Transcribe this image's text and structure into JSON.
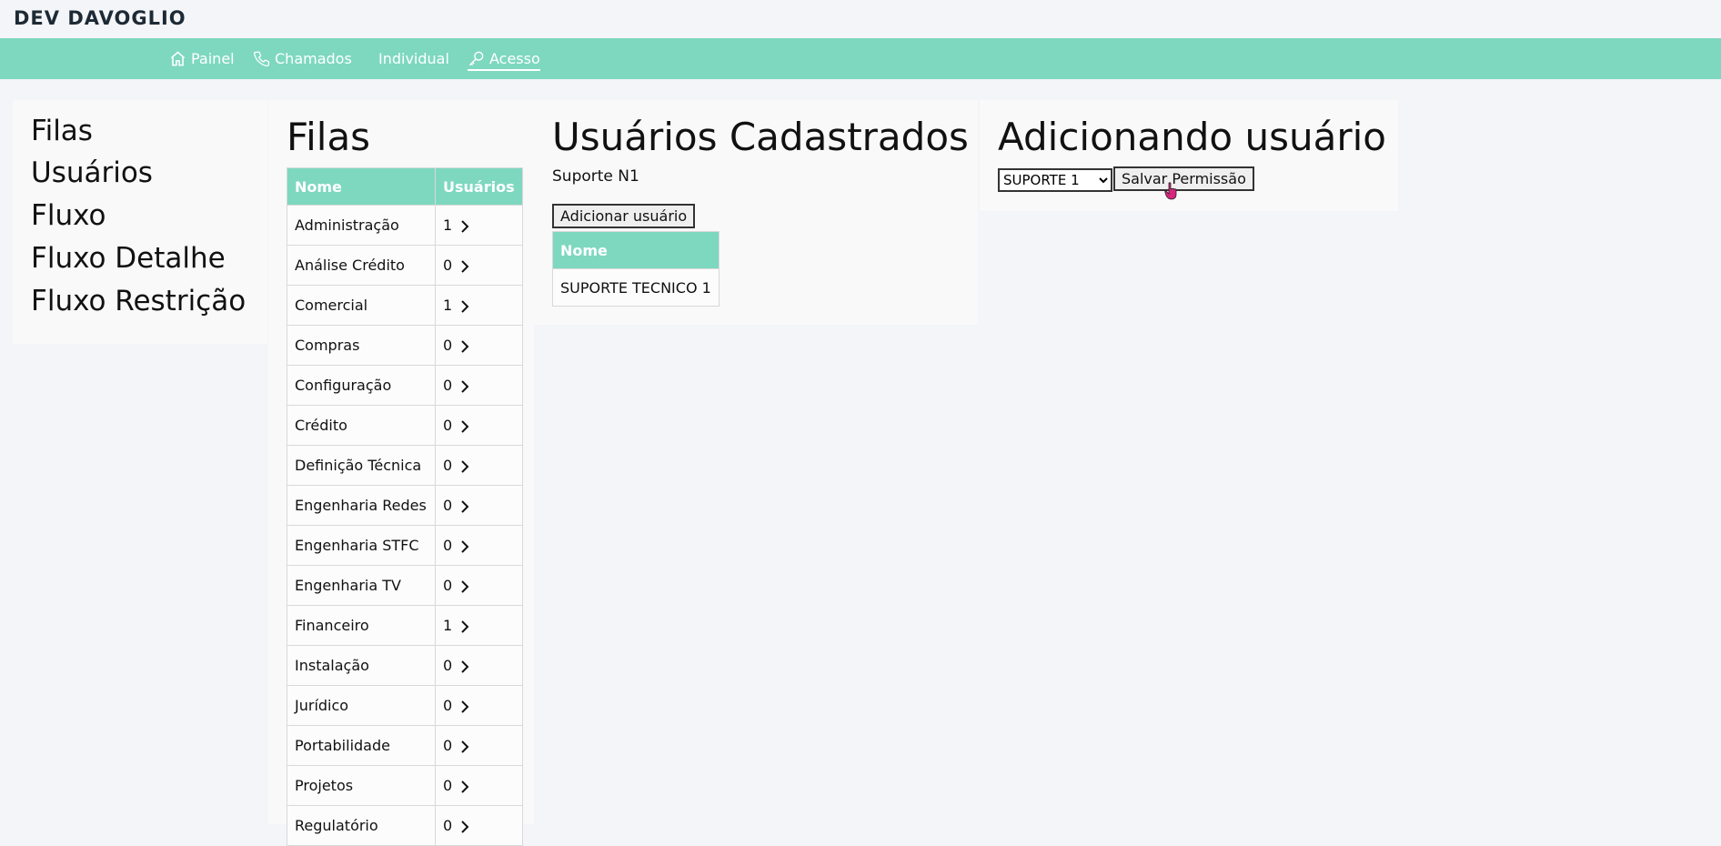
{
  "brand": "DEV DAVOGLIO",
  "nav": {
    "painel": "Painel",
    "chamados": "Chamados",
    "individual": "Individual",
    "acesso": "Acesso"
  },
  "left_menu": [
    "Filas",
    "Usuários",
    "Fluxo",
    "Fluxo Detalhe",
    "Fluxo Restrição"
  ],
  "queues": {
    "title": "Filas",
    "headers": [
      "Nome",
      "Usuários"
    ],
    "rows": [
      {
        "name": "Administração",
        "count": "1"
      },
      {
        "name": "Análise Crédito",
        "count": "0"
      },
      {
        "name": "Comercial",
        "count": "1"
      },
      {
        "name": "Compras",
        "count": "0"
      },
      {
        "name": "Configuração",
        "count": "0"
      },
      {
        "name": "Crédito",
        "count": "0"
      },
      {
        "name": "Definição Técnica",
        "count": "0"
      },
      {
        "name": "Engenharia Redes",
        "count": "0"
      },
      {
        "name": "Engenharia STFC",
        "count": "0"
      },
      {
        "name": "Engenharia TV",
        "count": "0"
      },
      {
        "name": "Financeiro",
        "count": "1"
      },
      {
        "name": "Instalação",
        "count": "0"
      },
      {
        "name": "Jurídico",
        "count": "0"
      },
      {
        "name": "Portabilidade",
        "count": "0"
      },
      {
        "name": "Projetos",
        "count": "0"
      },
      {
        "name": "Regulatório",
        "count": "0"
      }
    ]
  },
  "users": {
    "title": "Usuários Cadastrados",
    "queue_name": "Suporte N1",
    "add_button": "Adicionar usuário",
    "table_header": "Nome",
    "rows": [
      "SUPORTE TECNICO 1"
    ]
  },
  "adding": {
    "title": "Adicionando usuário",
    "selected": "SUPORTE 1",
    "save_button": "Salvar Permissão"
  },
  "colors": {
    "accent": "#7dd8bf",
    "background": "#f4f5f8",
    "cursor": "#d6267d"
  }
}
